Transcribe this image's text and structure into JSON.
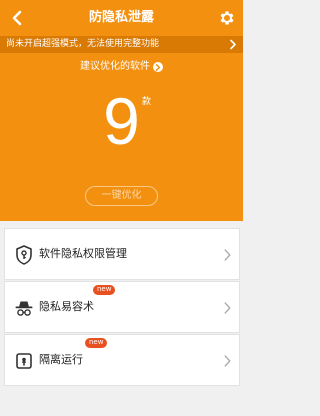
{
  "header": {
    "title": "防隐私泄露",
    "back_icon": "back-arrow-icon",
    "settings_icon": "gear-icon"
  },
  "notice": {
    "text": "尚未开启超强模式，无法使用完整功能"
  },
  "suggest": {
    "text": "建议优化的软件"
  },
  "summary": {
    "count": "9",
    "unit": "款"
  },
  "optimize_button": {
    "label": "一键优化"
  },
  "menu": [
    {
      "label": "软件隐私权限管理",
      "icon": "shield-key-icon",
      "badge": ""
    },
    {
      "label": "隐私易容术",
      "icon": "disguise-icon",
      "badge": "new"
    },
    {
      "label": "隔离运行",
      "icon": "isolation-icon",
      "badge": "new"
    }
  ],
  "colors": {
    "header_bg": "#f3900f",
    "notice_bg": "#d97a05",
    "badge_bg": "#e8501f",
    "page_bg": "#f0f0f0"
  }
}
